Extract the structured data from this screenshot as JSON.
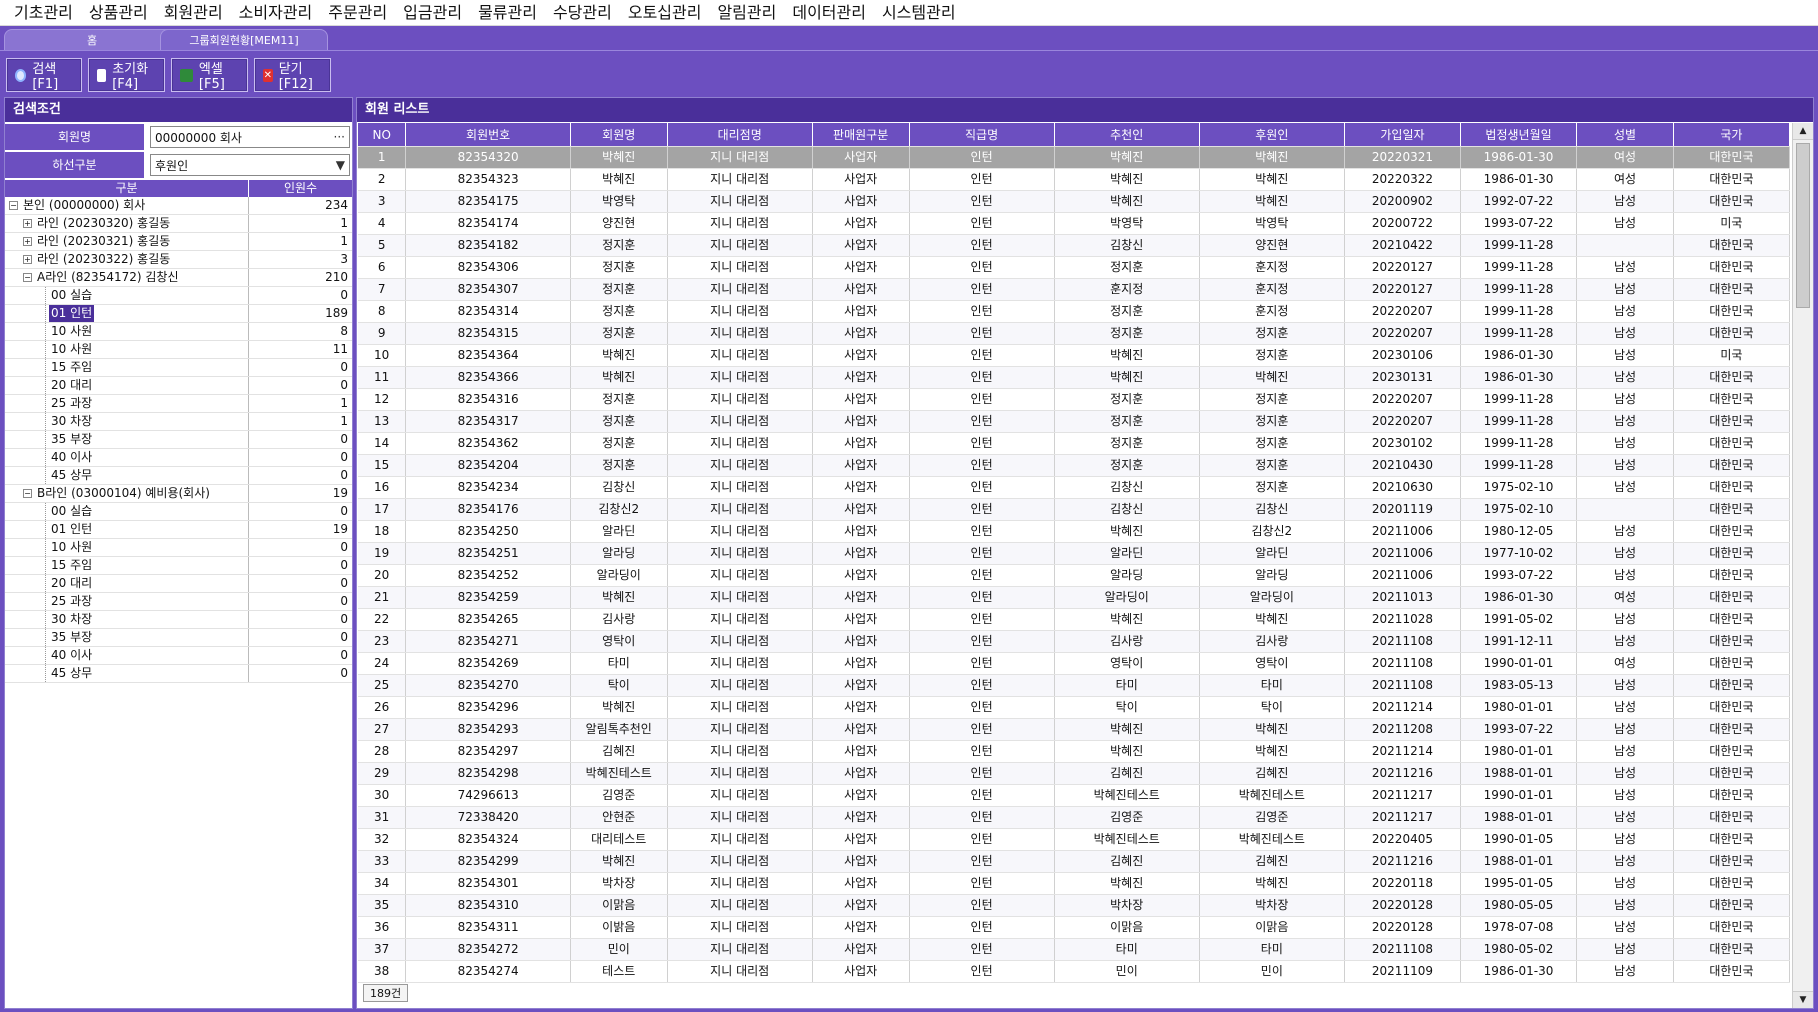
{
  "menu": [
    "기초관리",
    "상품관리",
    "회원관리",
    "소비자관리",
    "주문관리",
    "입금관리",
    "물류관리",
    "수당관리",
    "오토십관리",
    "알림관리",
    "데이터관리",
    "시스템관리"
  ],
  "tabs": {
    "home": "홈",
    "active": "그룹회원현황[MEM11]"
  },
  "toolbar": {
    "search": "검색[F1]",
    "reset": "초기화[F4]",
    "excel": "엑셀[F5]",
    "close": "닫기[F12]"
  },
  "left": {
    "title": "검색조건",
    "member_label": "회원명",
    "member_value": "00000000 회사",
    "lower_label": "하선구분",
    "lower_value": "후원인",
    "tree_head": {
      "name": "구분",
      "count": "인원수"
    },
    "tree": [
      {
        "lvl": 0,
        "exp": "−",
        "name": "본인 (00000000) 회사",
        "count": "234"
      },
      {
        "lvl": 1,
        "exp": "+",
        "name": "라인 (20230320) 홍길동",
        "count": "1"
      },
      {
        "lvl": 1,
        "exp": "+",
        "name": "라인 (20230321) 홍길동",
        "count": "1"
      },
      {
        "lvl": 1,
        "exp": "+",
        "name": "라인 (20230322) 홍길동",
        "count": "3"
      },
      {
        "lvl": 1,
        "exp": "−",
        "name": "A라인 (82354172) 김창신",
        "count": "210"
      },
      {
        "lvl": 2,
        "name": "00 실습",
        "count": "0"
      },
      {
        "lvl": 2,
        "name": "01 인턴",
        "count": "189",
        "sel": true
      },
      {
        "lvl": 2,
        "name": "10 사원",
        "count": "8"
      },
      {
        "lvl": 2,
        "name": "10 사원",
        "count": "11"
      },
      {
        "lvl": 2,
        "name": "15 주임",
        "count": "0"
      },
      {
        "lvl": 2,
        "name": "20 대리",
        "count": "0"
      },
      {
        "lvl": 2,
        "name": "25 과장",
        "count": "1"
      },
      {
        "lvl": 2,
        "name": "30 차장",
        "count": "1"
      },
      {
        "lvl": 2,
        "name": "35 부장",
        "count": "0"
      },
      {
        "lvl": 2,
        "name": "40 이사",
        "count": "0"
      },
      {
        "lvl": 2,
        "name": "45 상무",
        "count": "0"
      },
      {
        "lvl": 1,
        "exp": "−",
        "name": "B라인 (03000104) 예비용(회사)",
        "count": "19"
      },
      {
        "lvl": 2,
        "name": "00 실습",
        "count": "0"
      },
      {
        "lvl": 2,
        "name": "01 인턴",
        "count": "19"
      },
      {
        "lvl": 2,
        "name": "10 사원",
        "count": "0"
      },
      {
        "lvl": 2,
        "name": "15 주임",
        "count": "0"
      },
      {
        "lvl": 2,
        "name": "20 대리",
        "count": "0"
      },
      {
        "lvl": 2,
        "name": "25 과장",
        "count": "0"
      },
      {
        "lvl": 2,
        "name": "30 차장",
        "count": "0"
      },
      {
        "lvl": 2,
        "name": "35 부장",
        "count": "0"
      },
      {
        "lvl": 2,
        "name": "40 이사",
        "count": "0"
      },
      {
        "lvl": 2,
        "name": "45 상무",
        "count": "0"
      }
    ]
  },
  "grid": {
    "title": "회원 리스트",
    "columns": [
      "NO",
      "회원번호",
      "회원명",
      "대리점명",
      "판매원구분",
      "직급명",
      "추천인",
      "후원인",
      "가입일자",
      "법정생년월일",
      "성별",
      "국가"
    ],
    "rows": [
      [
        "1",
        "82354320",
        "박혜진",
        "지니 대리점",
        "사업자",
        "인턴",
        "박혜진",
        "박혜진",
        "20220321",
        "1986-01-30",
        "여성",
        "대한민국"
      ],
      [
        "2",
        "82354323",
        "박혜진",
        "지니 대리점",
        "사업자",
        "인턴",
        "박혜진",
        "박혜진",
        "20220322",
        "1986-01-30",
        "여성",
        "대한민국"
      ],
      [
        "3",
        "82354175",
        "박영탁",
        "지니 대리점",
        "사업자",
        "인턴",
        "박혜진",
        "박혜진",
        "20200902",
        "1992-07-22",
        "남성",
        "대한민국"
      ],
      [
        "4",
        "82354174",
        "양진현",
        "지니 대리점",
        "사업자",
        "인턴",
        "박영탁",
        "박영탁",
        "20200722",
        "1993-07-22",
        "남성",
        "미국"
      ],
      [
        "5",
        "82354182",
        "정지훈",
        "지니 대리점",
        "사업자",
        "인턴",
        "김창신",
        "양진현",
        "20210422",
        "1999-11-28",
        "",
        "대한민국"
      ],
      [
        "6",
        "82354306",
        "정지훈",
        "지니 대리점",
        "사업자",
        "인턴",
        "정지훈",
        "훈지정",
        "20220127",
        "1999-11-28",
        "남성",
        "대한민국"
      ],
      [
        "7",
        "82354307",
        "정지훈",
        "지니 대리점",
        "사업자",
        "인턴",
        "훈지정",
        "훈지정",
        "20220127",
        "1999-11-28",
        "남성",
        "대한민국"
      ],
      [
        "8",
        "82354314",
        "정지훈",
        "지니 대리점",
        "사업자",
        "인턴",
        "정지훈",
        "훈지정",
        "20220207",
        "1999-11-28",
        "남성",
        "대한민국"
      ],
      [
        "9",
        "82354315",
        "정지훈",
        "지니 대리점",
        "사업자",
        "인턴",
        "정지훈",
        "정지훈",
        "20220207",
        "1999-11-28",
        "남성",
        "대한민국"
      ],
      [
        "10",
        "82354364",
        "박혜진",
        "지니 대리점",
        "사업자",
        "인턴",
        "박혜진",
        "정지훈",
        "20230106",
        "1986-01-30",
        "남성",
        "미국"
      ],
      [
        "11",
        "82354366",
        "박혜진",
        "지니 대리점",
        "사업자",
        "인턴",
        "박혜진",
        "박혜진",
        "20230131",
        "1986-01-30",
        "남성",
        "대한민국"
      ],
      [
        "12",
        "82354316",
        "정지훈",
        "지니 대리점",
        "사업자",
        "인턴",
        "정지훈",
        "정지훈",
        "20220207",
        "1999-11-28",
        "남성",
        "대한민국"
      ],
      [
        "13",
        "82354317",
        "정지훈",
        "지니 대리점",
        "사업자",
        "인턴",
        "정지훈",
        "정지훈",
        "20220207",
        "1999-11-28",
        "남성",
        "대한민국"
      ],
      [
        "14",
        "82354362",
        "정지훈",
        "지니 대리점",
        "사업자",
        "인턴",
        "정지훈",
        "정지훈",
        "20230102",
        "1999-11-28",
        "남성",
        "대한민국"
      ],
      [
        "15",
        "82354204",
        "정지훈",
        "지니 대리점",
        "사업자",
        "인턴",
        "정지훈",
        "정지훈",
        "20210430",
        "1999-11-28",
        "남성",
        "대한민국"
      ],
      [
        "16",
        "82354234",
        "김창신",
        "지니 대리점",
        "사업자",
        "인턴",
        "김창신",
        "정지훈",
        "20210630",
        "1975-02-10",
        "남성",
        "대한민국"
      ],
      [
        "17",
        "82354176",
        "김창신2",
        "지니 대리점",
        "사업자",
        "인턴",
        "김창신",
        "김창신",
        "20201119",
        "1975-02-10",
        "",
        "대한민국"
      ],
      [
        "18",
        "82354250",
        "알라딘",
        "지니 대리점",
        "사업자",
        "인턴",
        "박혜진",
        "김창신2",
        "20211006",
        "1980-12-05",
        "남성",
        "대한민국"
      ],
      [
        "19",
        "82354251",
        "알라딩",
        "지니 대리점",
        "사업자",
        "인턴",
        "알라딘",
        "알라딘",
        "20211006",
        "1977-10-02",
        "남성",
        "대한민국"
      ],
      [
        "20",
        "82354252",
        "알라딩이",
        "지니 대리점",
        "사업자",
        "인턴",
        "알라딩",
        "알라딩",
        "20211006",
        "1993-07-22",
        "남성",
        "대한민국"
      ],
      [
        "21",
        "82354259",
        "박혜진",
        "지니 대리점",
        "사업자",
        "인턴",
        "알라딩이",
        "알라딩이",
        "20211013",
        "1986-01-30",
        "여성",
        "대한민국"
      ],
      [
        "22",
        "82354265",
        "김사랑",
        "지니 대리점",
        "사업자",
        "인턴",
        "박혜진",
        "박혜진",
        "20211028",
        "1991-05-02",
        "남성",
        "대한민국"
      ],
      [
        "23",
        "82354271",
        "영탁이",
        "지니 대리점",
        "사업자",
        "인턴",
        "김사랑",
        "김사랑",
        "20211108",
        "1991-12-11",
        "남성",
        "대한민국"
      ],
      [
        "24",
        "82354269",
        "타미",
        "지니 대리점",
        "사업자",
        "인턴",
        "영탁이",
        "영탁이",
        "20211108",
        "1990-01-01",
        "여성",
        "대한민국"
      ],
      [
        "25",
        "82354270",
        "탁이",
        "지니 대리점",
        "사업자",
        "인턴",
        "타미",
        "타미",
        "20211108",
        "1983-05-13",
        "남성",
        "대한민국"
      ],
      [
        "26",
        "82354296",
        "박혜진",
        "지니 대리점",
        "사업자",
        "인턴",
        "탁이",
        "탁이",
        "20211214",
        "1980-01-01",
        "남성",
        "대한민국"
      ],
      [
        "27",
        "82354293",
        "알림톡추천인",
        "지니 대리점",
        "사업자",
        "인턴",
        "박혜진",
        "박혜진",
        "20211208",
        "1993-07-22",
        "남성",
        "대한민국"
      ],
      [
        "28",
        "82354297",
        "김혜진",
        "지니 대리점",
        "사업자",
        "인턴",
        "박혜진",
        "박혜진",
        "20211214",
        "1980-01-01",
        "남성",
        "대한민국"
      ],
      [
        "29",
        "82354298",
        "박혜진테스트",
        "지니 대리점",
        "사업자",
        "인턴",
        "김혜진",
        "김혜진",
        "20211216",
        "1988-01-01",
        "남성",
        "대한민국"
      ],
      [
        "30",
        "74296613",
        "김영준",
        "지니 대리점",
        "사업자",
        "인턴",
        "박혜진테스트",
        "박혜진테스트",
        "20211217",
        "1990-01-01",
        "남성",
        "대한민국"
      ],
      [
        "31",
        "72338420",
        "안현준",
        "지니 대리점",
        "사업자",
        "인턴",
        "김영준",
        "김영준",
        "20211217",
        "1988-01-01",
        "남성",
        "대한민국"
      ],
      [
        "32",
        "82354324",
        "대리테스트",
        "지니 대리점",
        "사업자",
        "인턴",
        "박혜진테스트",
        "박혜진테스트",
        "20220405",
        "1990-01-05",
        "남성",
        "대한민국"
      ],
      [
        "33",
        "82354299",
        "박혜진",
        "지니 대리점",
        "사업자",
        "인턴",
        "김혜진",
        "김혜진",
        "20211216",
        "1988-01-01",
        "남성",
        "대한민국"
      ],
      [
        "34",
        "82354301",
        "박차장",
        "지니 대리점",
        "사업자",
        "인턴",
        "박혜진",
        "박혜진",
        "20220118",
        "1995-01-05",
        "남성",
        "대한민국"
      ],
      [
        "35",
        "82354310",
        "이맑음",
        "지니 대리점",
        "사업자",
        "인턴",
        "박차장",
        "박차장",
        "20220128",
        "1980-05-05",
        "남성",
        "대한민국"
      ],
      [
        "36",
        "82354311",
        "이밝음",
        "지니 대리점",
        "사업자",
        "인턴",
        "이맑음",
        "이맑음",
        "20220128",
        "1978-07-08",
        "남성",
        "대한민국"
      ],
      [
        "37",
        "82354272",
        "민이",
        "지니 대리점",
        "사업자",
        "인턴",
        "타미",
        "타미",
        "20211108",
        "1980-05-02",
        "남성",
        "대한민국"
      ],
      [
        "38",
        "82354274",
        "테스트",
        "지니 대리점",
        "사업자",
        "인턴",
        "민이",
        "민이",
        "20211109",
        "1986-01-30",
        "남성",
        "대한민국"
      ]
    ],
    "footer_count": "189건"
  }
}
